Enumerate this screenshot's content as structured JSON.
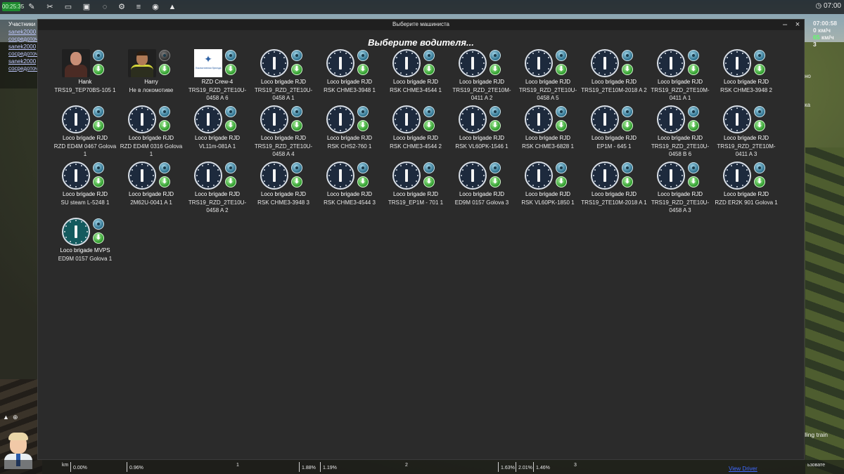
{
  "topbar": {
    "timer": "00:25:35",
    "clock": "07:00"
  },
  "left_panel": {
    "title": "Участники",
    "rows": [
      "sanek2000",
      "сосредоточ",
      "sanek2000",
      "сосредоточ",
      "sanek2000",
      "сосредоточ"
    ]
  },
  "right_panel": {
    "time": "07:00:58",
    "speed_line1": "0 км/ч",
    "speed_value": "65",
    "speed_unit": " км/ч",
    "gear": "3",
    "frag1": "но",
    "frag2": "ка"
  },
  "dialog": {
    "window_title": "Выберите машиниста",
    "minimize": "–",
    "close": "×",
    "heading": "Выберите водителя..."
  },
  "drivers": [
    {
      "kind": "hank",
      "name": "Hank",
      "loco": "TRS19_TEP70BS-105 1"
    },
    {
      "kind": "harry",
      "name": "Harry",
      "loco": "Не в локомотиве"
    },
    {
      "kind": "logo",
      "name": "RZD Crew-4",
      "loco": "TRS19_RZD_2TE10U-0458 A 6"
    },
    {
      "kind": "clock",
      "name": "Loco brigade RJD",
      "loco": "TRS19_RZD_2TE10U-0458 A 1"
    },
    {
      "kind": "clock",
      "name": "Loco brigade RJD",
      "loco": "RSK CHME3-3948 1"
    },
    {
      "kind": "clock",
      "name": "Loco brigade RJD",
      "loco": "RSK CHME3-4544 1"
    },
    {
      "kind": "clock",
      "name": "Loco brigade RJD",
      "loco": "TRS19_RZD_2TE10M-0411 A 2"
    },
    {
      "kind": "clock",
      "name": "Loco brigade RJD",
      "loco": "TRS19_RZD_2TE10U-0458 A 5"
    },
    {
      "kind": "clock",
      "name": "Loco brigade RJD",
      "loco": "TRS19_2TE10M-2018 A 2"
    },
    {
      "kind": "clock",
      "name": "Loco brigade RJD",
      "loco": "TRS19_RZD_2TE10M-0411 A 1"
    },
    {
      "kind": "clock",
      "name": "Loco brigade RJD",
      "loco": "RSK CHME3-3948 2"
    },
    {
      "kind": "clock",
      "name": "Loco brigade RJD",
      "loco": "RZD ED4M 0467 Golova 1"
    },
    {
      "kind": "clock",
      "name": "Loco brigade RJD",
      "loco": "RZD ED4M 0316 Golova 1"
    },
    {
      "kind": "clock",
      "name": "Loco brigade RJD",
      "loco": "VL11m-081A 1"
    },
    {
      "kind": "clock",
      "name": "Loco brigade RJD",
      "loco": "TRS19_RZD_2TE10U-0458 A 4"
    },
    {
      "kind": "clock",
      "name": "Loco brigade RJD",
      "loco": "RSK CHS2-760 1"
    },
    {
      "kind": "clock",
      "name": "Loco brigade RJD",
      "loco": "RSK CHME3-4544 2"
    },
    {
      "kind": "clock",
      "name": "Loco brigade RJD",
      "loco": "RSK VL60PK-1546 1"
    },
    {
      "kind": "clock",
      "name": "Loco brigade RJD",
      "loco": "RSK CHME3-6828 1"
    },
    {
      "kind": "clock",
      "name": "Loco brigade RJD",
      "loco": "EP1M - 645 1"
    },
    {
      "kind": "clock",
      "name": "Loco brigade RJD",
      "loco": "TRS19_RZD_2TE10U-0458 B 6"
    },
    {
      "kind": "clock",
      "name": "Loco brigade RJD",
      "loco": "TRS19_RZD_2TE10M-0411 A 3"
    },
    {
      "kind": "clock",
      "name": "Loco brigade RJD",
      "loco": "SU steam L-5248 1"
    },
    {
      "kind": "clock",
      "name": "Loco brigade RJD",
      "loco": "2M62U-0041 A 1"
    },
    {
      "kind": "clock",
      "name": "Loco brigade RJD",
      "loco": "TRS19_RZD_2TE10U-0458 A 2"
    },
    {
      "kind": "clock",
      "name": "Loco brigade RJD",
      "loco": "RSK CHME3-3948 3"
    },
    {
      "kind": "clock",
      "name": "Loco brigade RJD",
      "loco": "RSK CHME3-4544 3"
    },
    {
      "kind": "clock",
      "name": "Loco brigade RJD",
      "loco": "TRS19_EP1M - 701 1"
    },
    {
      "kind": "clock",
      "name": "Loco brigade RJD",
      "loco": "ED9M 0157 Golova 3"
    },
    {
      "kind": "clock",
      "name": "Loco brigade RJD",
      "loco": "RSK VL60PK-1850 1"
    },
    {
      "kind": "clock",
      "name": "Loco brigade RJD",
      "loco": "TRS19_2TE10M-2018 A 1"
    },
    {
      "kind": "clock",
      "name": "Loco brigade RJD",
      "loco": "TRS19_RZD_2TE10U-0458 A 3"
    },
    {
      "kind": "clock",
      "name": "Loco brigade RJD",
      "loco": "RZD ER2K 901 Golova 1"
    },
    {
      "kind": "clock-teal",
      "name": "Loco brigade MVPS",
      "loco": "ED9M 0157 Golova 1"
    }
  ],
  "logo_text": "Локомотивная бригада",
  "bottombar": {
    "km_label": "km",
    "ticks": [
      "0.00%",
      "0.96%",
      "1",
      "1.88%",
      "1.19%",
      "2",
      "1.63%",
      "2.01%",
      "1.46%",
      "3"
    ],
    "view_driver": "View Driver",
    "right_frag": "ьзовате"
  },
  "rolling_train": "lling train"
}
